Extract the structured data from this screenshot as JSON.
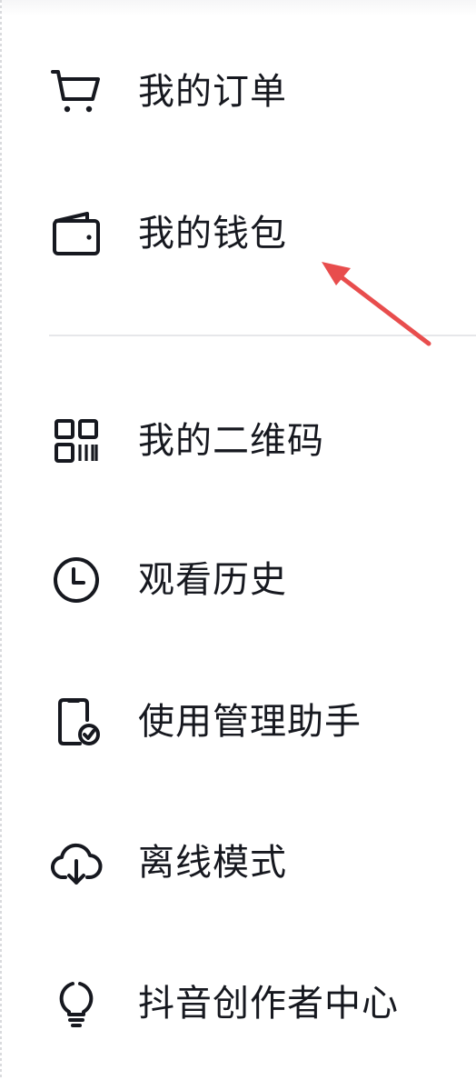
{
  "menu": {
    "items": [
      {
        "label": "我的订单",
        "icon": "cart-icon"
      },
      {
        "label": "我的钱包",
        "icon": "wallet-icon"
      },
      {
        "label": "我的二维码",
        "icon": "qrcode-icon"
      },
      {
        "label": "观看历史",
        "icon": "clock-icon"
      },
      {
        "label": "使用管理助手",
        "icon": "phone-check-icon"
      },
      {
        "label": "离线模式",
        "icon": "cloud-download-icon"
      },
      {
        "label": "抖音创作者中心",
        "icon": "lightbulb-icon"
      }
    ]
  },
  "colors": {
    "text": "#16181f",
    "divider": "#e6e7ea",
    "annotation_arrow": "#e84d4d"
  }
}
